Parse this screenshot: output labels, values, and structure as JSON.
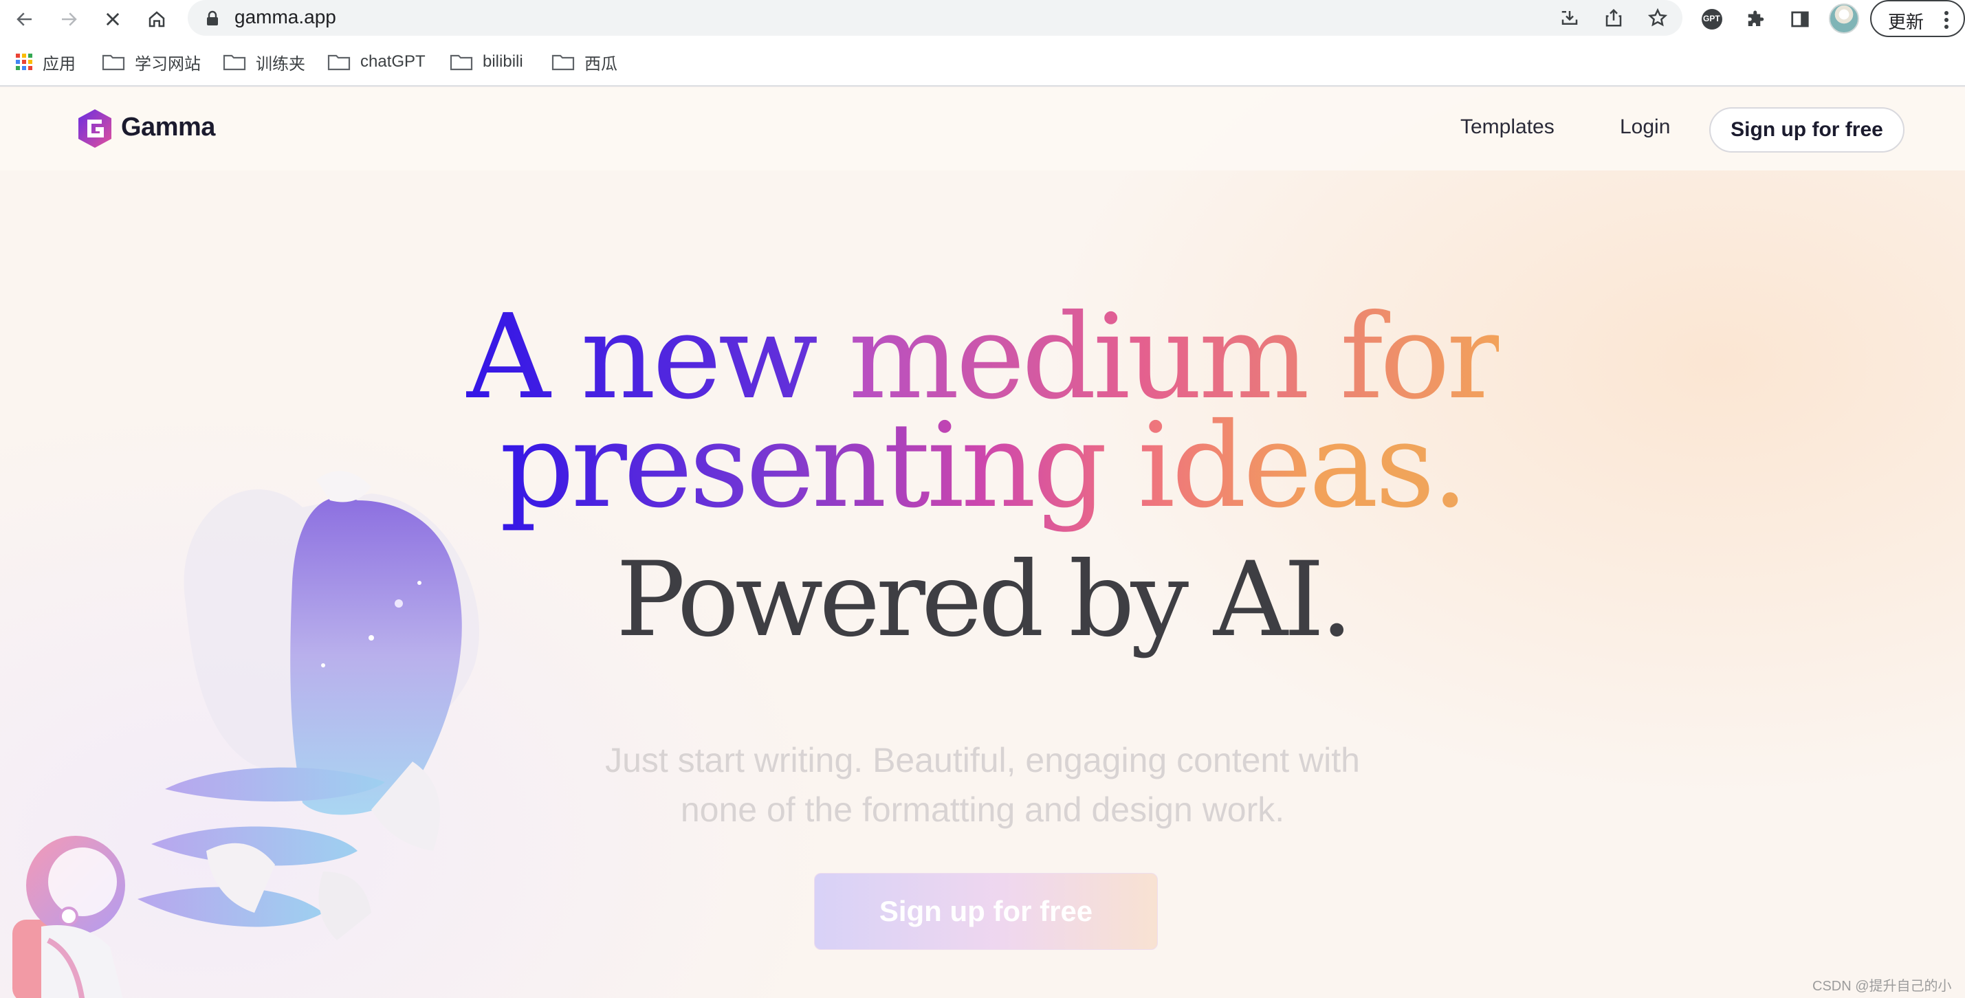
{
  "browser": {
    "url": "gamma.app",
    "update_label": "更新",
    "bookmarks": [
      {
        "label": "应用",
        "icon": "apps-grid-icon"
      },
      {
        "label": "学习网站",
        "icon": "folder-icon"
      },
      {
        "label": "训练夹",
        "icon": "folder-icon"
      },
      {
        "label": "chatGPT",
        "icon": "folder-icon"
      },
      {
        "label": "bilibili",
        "icon": "folder-icon"
      },
      {
        "label": "西瓜",
        "icon": "folder-icon"
      }
    ],
    "extension_badge": "GPT"
  },
  "nav": {
    "brand": "Gamma",
    "links": [
      "Templates",
      "Login"
    ],
    "signup_label": "Sign up for free"
  },
  "hero": {
    "line1_a": "A new ",
    "line1_b": "medium for",
    "line2": "presenting ideas.",
    "line3": "Powered by AI.",
    "subtitle_line1": "Just start writing. Beautiful, engaging content with",
    "subtitle_line2": "none of the formatting and design work.",
    "cta_label": "Sign up for free"
  },
  "colors": {
    "gradient_start": "#3417e6",
    "gradient_mid": "#c544b6",
    "gradient_end": "#f2a25a",
    "dark_text": "#3e3e43"
  },
  "watermark": "CSDN @提升自己的小白"
}
